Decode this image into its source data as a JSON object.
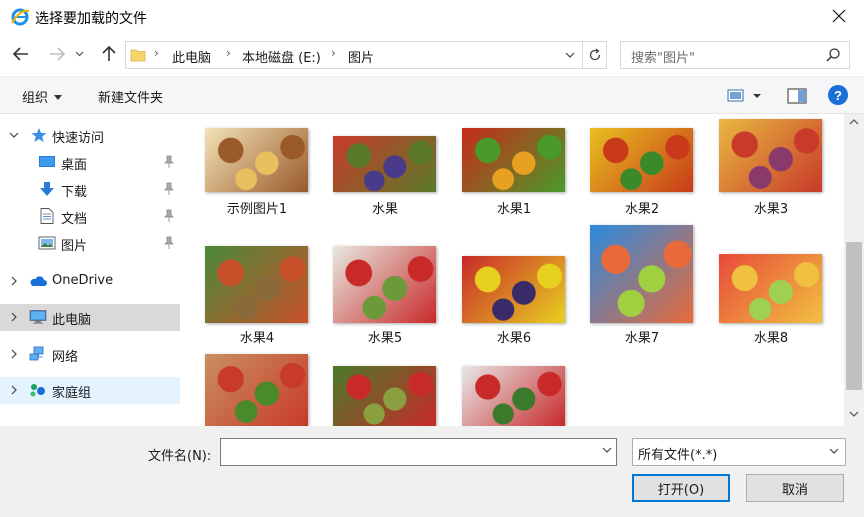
{
  "window": {
    "title": "选择要加载的文件"
  },
  "address": {
    "crumbs": [
      "此电脑",
      "本地磁盘 (E:)",
      "图片"
    ]
  },
  "search": {
    "placeholder": "搜索\"图片\""
  },
  "toolbar": {
    "organize": "组织",
    "new_folder": "新建文件夹",
    "help": "?"
  },
  "sidebar": {
    "items": [
      {
        "label": "快速访问",
        "icon": "star-icon"
      },
      {
        "label": "桌面",
        "icon": "desktop-icon",
        "pinned": true
      },
      {
        "label": "下载",
        "icon": "download-icon",
        "pinned": true
      },
      {
        "label": "文档",
        "icon": "document-icon",
        "pinned": true
      },
      {
        "label": "图片",
        "icon": "pictures-icon",
        "pinned": true
      },
      {
        "label": "OneDrive",
        "icon": "cloud-icon"
      },
      {
        "label": "此电脑",
        "icon": "computer-icon"
      },
      {
        "label": "网络",
        "icon": "network-icon"
      },
      {
        "label": "家庭组",
        "icon": "homegroup-icon"
      }
    ]
  },
  "files": [
    {
      "name": "示例图片1",
      "colors": [
        "#f3e3b8",
        "#9a5a2a",
        "#e8c060"
      ]
    },
    {
      "name": "水果",
      "colors": [
        "#c83a2a",
        "#5a7a2a",
        "#4a3a8a"
      ]
    },
    {
      "name": "水果1",
      "colors": [
        "#c82a1a",
        "#4a9a2a",
        "#e8a020"
      ]
    },
    {
      "name": "水果2",
      "colors": [
        "#e8c020",
        "#c83a1a",
        "#3a8a2a"
      ]
    },
    {
      "name": "水果3",
      "colors": [
        "#e8b840",
        "#c83a2a",
        "#8a3a6a"
      ]
    },
    {
      "name": "水果4",
      "colors": [
        "#4a8a3a",
        "#c8502a",
        "#8a6a3a"
      ]
    },
    {
      "name": "水果5",
      "colors": [
        "#e8e8e0",
        "#c82a2a",
        "#6a9a3a"
      ]
    },
    {
      "name": "水果6",
      "colors": [
        "#c82a2a",
        "#e8d020",
        "#3a2a6a"
      ]
    },
    {
      "name": "水果7",
      "colors": [
        "#2a8ae0",
        "#e86a3a",
        "#a0d040"
      ]
    },
    {
      "name": "水果8",
      "colors": [
        "#e84a3a",
        "#f0c040",
        "#a0d050"
      ]
    },
    {
      "name": "",
      "colors": [
        "#c89060",
        "#c83a2a",
        "#4a8a2a"
      ]
    },
    {
      "name": "",
      "colors": [
        "#4a7a2a",
        "#c82a2a",
        "#8aa040"
      ]
    },
    {
      "name": "",
      "colors": [
        "#e8e8e8",
        "#c82a2a",
        "#3a7a2a"
      ]
    }
  ],
  "bottom": {
    "filename_label": "文件名(N):",
    "filename_value": "",
    "filetype": "所有文件(*.*)",
    "open": "打开(O)",
    "cancel": "取消"
  },
  "accent": "#0078d7"
}
